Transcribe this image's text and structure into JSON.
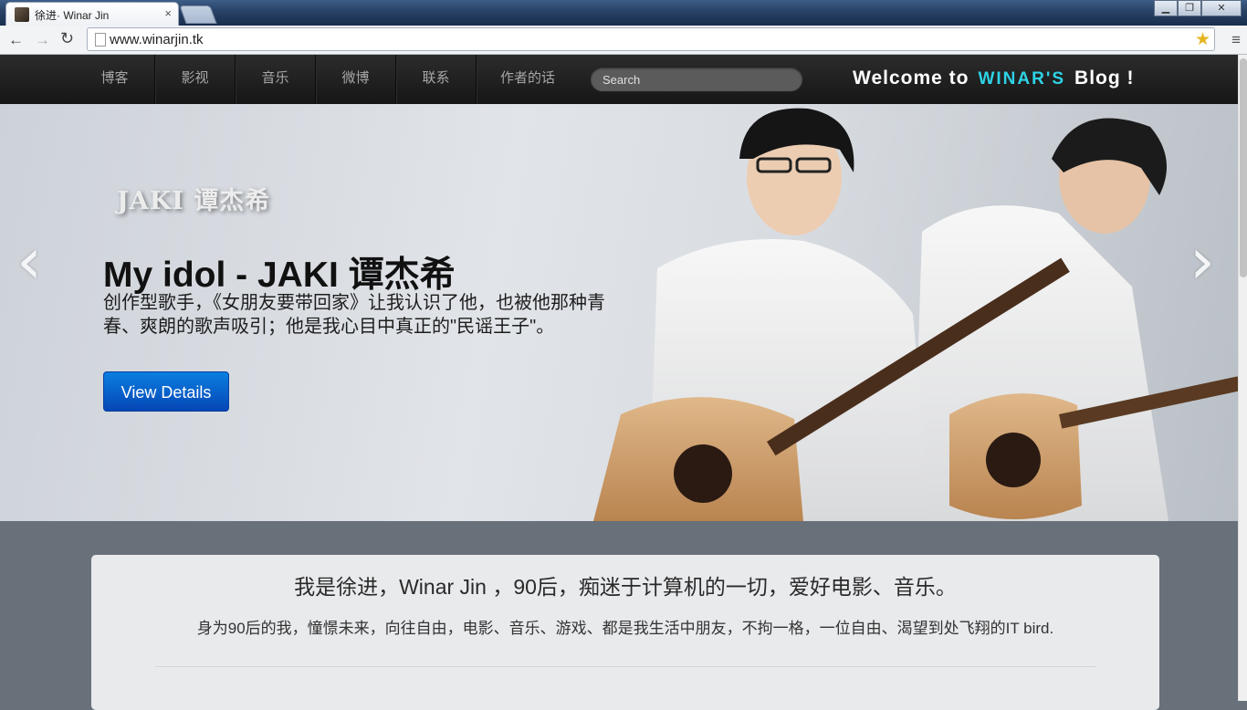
{
  "browser": {
    "tab_title": "徐进· Winar Jin",
    "tab_close": "×",
    "url": "www.winarjin.tk",
    "back": "←",
    "forward": "→",
    "reload": "↻",
    "star": "★",
    "menu": "≡",
    "window_buttons": {
      "minimize": "▁",
      "maximize": "❐",
      "close": "✕"
    }
  },
  "navbar": {
    "items": [
      {
        "label": "博客"
      },
      {
        "label": "影视"
      },
      {
        "label": "音乐"
      },
      {
        "label": "微博"
      },
      {
        "label": "联系"
      },
      {
        "label": "作者的话"
      }
    ],
    "search_placeholder": "Search",
    "welcome_prefix": "Welcome to",
    "welcome_brand": "WINAR'S",
    "welcome_suffix": "Blog !"
  },
  "hero": {
    "logo_text": "JAKI 谭杰希",
    "title": "My idol - JAKI 谭杰希",
    "description": "创作型歌手，《女朋友要带回家》让我认识了他，也被他那种青春、爽朗的歌声吸引；他是我心目中真正的\"民谣王子\"。",
    "button_label": "View Details",
    "prev_arrow": "‹",
    "next_arrow": "›"
  },
  "intro": {
    "heading": "我是徐进，Winar Jin ，90后，痴迷于计算机的一切，爱好电影、音乐。",
    "subtext": "身为90后的我，憧憬未来，向往自由，电影、音乐、游戏、都是我生活中朋友，不拘一格，一位自由、渴望到处飞翔的IT bird."
  },
  "colors": {
    "navbar_bg": "#1c1c1c",
    "brand_accent": "#2ed3e6",
    "button_blue": "#0b6fd8",
    "page_bg": "#68707a"
  }
}
